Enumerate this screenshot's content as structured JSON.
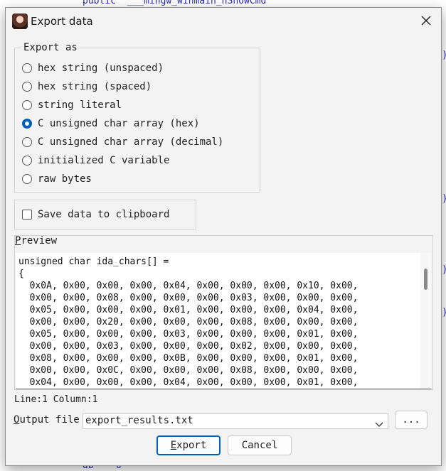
{
  "background": {
    "code_line_top": "public  ___mingw_winmain_nShowCmd",
    "code_line_bottom": "db    0"
  },
  "dialog": {
    "title": "Export data",
    "close_glyph": "✕",
    "export_as": {
      "legend": "Export as",
      "options": [
        {
          "label": "hex string (unspaced)",
          "selected": false
        },
        {
          "label": "hex string (spaced)",
          "selected": false
        },
        {
          "label": "string literal",
          "selected": false
        },
        {
          "label": "C unsigned char array (hex)",
          "selected": true
        },
        {
          "label": "C unsigned char array (decimal)",
          "selected": false
        },
        {
          "label": "initialized C variable",
          "selected": false
        },
        {
          "label": "raw bytes",
          "selected": false
        }
      ]
    },
    "save_to_clipboard": {
      "label": "Save data to clipboard",
      "checked": false
    },
    "preview": {
      "label_underlined": "P",
      "label_rest": "review",
      "lines": [
        "unsigned char ida_chars[] =",
        "{",
        "  0x0A, 0x00, 0x00, 0x00, 0x04, 0x00, 0x00, 0x00, 0x10, 0x00,",
        "  0x00, 0x00, 0x08, 0x00, 0x00, 0x00, 0x03, 0x00, 0x00, 0x00,",
        "  0x05, 0x00, 0x00, 0x00, 0x01, 0x00, 0x00, 0x00, 0x04, 0x00,",
        "  0x00, 0x00, 0x20, 0x00, 0x00, 0x00, 0x08, 0x00, 0x00, 0x00,",
        "  0x05, 0x00, 0x00, 0x00, 0x03, 0x00, 0x00, 0x00, 0x01, 0x00,",
        "  0x00, 0x00, 0x03, 0x00, 0x00, 0x00, 0x02, 0x00, 0x00, 0x00,",
        "  0x08, 0x00, 0x00, 0x00, 0x0B, 0x00, 0x00, 0x00, 0x01, 0x00,",
        "  0x00, 0x00, 0x0C, 0x00, 0x00, 0x00, 0x08, 0x00, 0x00, 0x00,",
        "  0x04, 0x00, 0x00, 0x00, 0x04, 0x00, 0x00, 0x00, 0x01, 0x00,"
      ]
    },
    "status": "Line:1  Column:1",
    "output_file": {
      "label_underlined": "O",
      "label_rest": "utput file",
      "value": "export_results.txt",
      "browse_label": "..."
    },
    "buttons": {
      "export_underlined": "E",
      "export_rest": "xport",
      "cancel": "Cancel"
    },
    "colors": {
      "accent": "#005fb8",
      "dialog_bg": "#f3f3f3"
    }
  }
}
